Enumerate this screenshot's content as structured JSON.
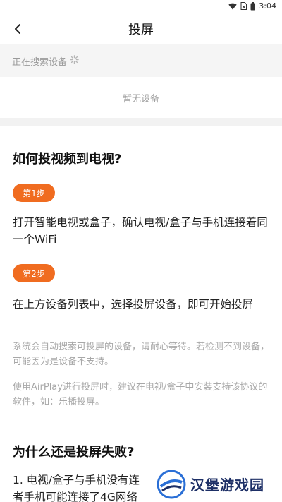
{
  "status": {
    "time": "3:04",
    "icons": [
      "wifi-icon",
      "sim-icon",
      "battery-icon"
    ]
  },
  "header": {
    "title": "投屏",
    "back_icon": "chevron-left-icon"
  },
  "search": {
    "status_text": "正在搜索设备",
    "spinner_icon": "loading-spinner-icon"
  },
  "devices": {
    "empty_text": "暂无设备"
  },
  "help": {
    "how_title": "如何投视频到电视?",
    "steps": [
      {
        "badge": "第1步",
        "text": "打开智能电视或盒子，确认电视/盒子与手机连接着同一个WiFi"
      },
      {
        "badge": "第2步",
        "text": "在上方设备列表中，选择投屏设备，即可开始投屏"
      }
    ],
    "notes": [
      "系统会自动搜索可投屏的设备，请耐心等待。若检测不到设备，可能因为是设备不支持。",
      "使用AirPlay进行投屏时，建议在电视/盒子中安装支持该协议的软件，如：乐播投屏。"
    ],
    "fail_title": "为什么还是投屏失败?",
    "fail_items": [
      "1. 电视/盒子与手机没有连",
      "者手机可能连接了4G网络"
    ]
  },
  "watermark": {
    "text": "汉堡游戏园"
  },
  "colors": {
    "accent": "#f06c20",
    "watermark": "#1d2f66"
  }
}
